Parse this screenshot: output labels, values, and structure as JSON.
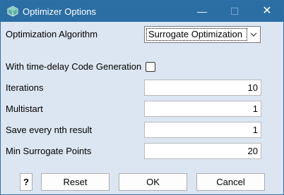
{
  "window": {
    "title": "Optimizer Options",
    "controls": {
      "minimize": "—",
      "maximize": "☐",
      "close": "✕"
    }
  },
  "form": {
    "algorithm_label": "Optimization Algorithm",
    "algorithm_value": "Surrogate Optimization",
    "timedelay_label": "With time-delay Code Generation",
    "timedelay_checked": false,
    "iterations_label": "Iterations",
    "iterations_value": "10",
    "multistart_label": "Multistart",
    "multistart_value": "1",
    "save_label": "Save every nth result",
    "save_value": "1",
    "minpoints_label": "Min Surrogate Points",
    "minpoints_value": "20"
  },
  "buttons": {
    "help": "?",
    "reset": "Reset",
    "ok": "OK",
    "cancel": "Cancel"
  },
  "colors": {
    "titlebar": "#2b6ea4",
    "dialog_bg": "#dce6f2"
  }
}
